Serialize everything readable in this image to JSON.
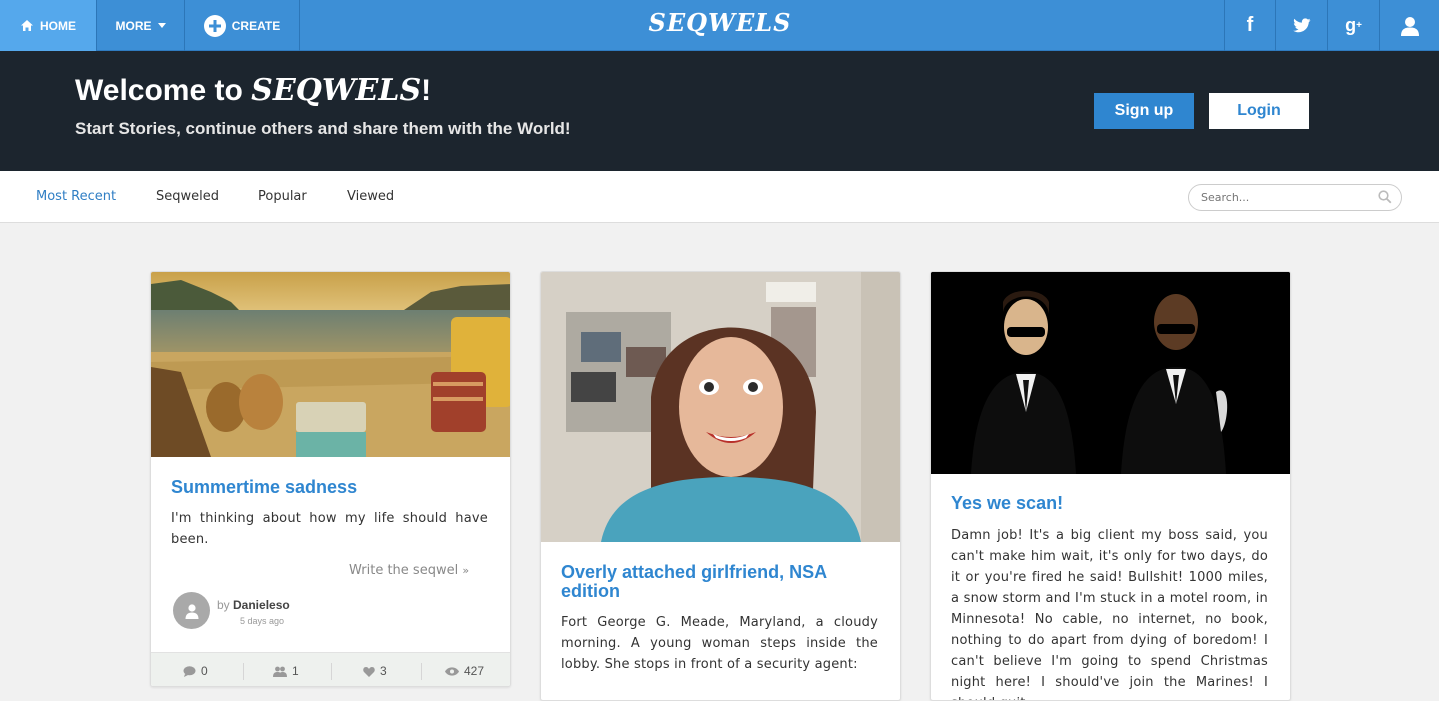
{
  "nav": {
    "home": "HOME",
    "more": "MORE",
    "create": "CREATE",
    "brand": "SEQWELS"
  },
  "hero": {
    "title_prefix": "Welcome to ",
    "title_brand": "SEQWELS",
    "title_suffix": "!",
    "subtitle": "Start Stories, continue others and share them with the World!",
    "signup": "Sign up",
    "login": "Login"
  },
  "filters": {
    "tabs": [
      "Most Recent",
      "Seqweled",
      "Popular",
      "Viewed"
    ],
    "active_tab": "Most Recent",
    "search_placeholder": "Search..."
  },
  "cards": [
    {
      "title": "Summertime sadness",
      "text": "I'm thinking about how my life should have been.",
      "write_seqwel": "Write the seqwel",
      "author_prefix": "by ",
      "author": "Danieleso",
      "time": "5 days ago",
      "stats": {
        "comments": "0",
        "seqwels": "1",
        "likes": "3",
        "views": "427"
      }
    },
    {
      "title": "Overly attached girlfriend, NSA edition",
      "text": "Fort George G. Meade, Maryland, a cloudy morning. A young woman steps inside the lobby. She stops in front of a security agent:"
    },
    {
      "title": "Yes we scan!",
      "text": "Damn job! It's a big client my boss said, you can't make him wait, it's only for two days, do it or you're fired he said! Bullshit! 1000 miles, a snow storm and I'm stuck in a motel room, in Minnesota! No cable, no internet, no book, nothing to do apart from dying of boredom! I can't believe I'm going to spend Christmas night here! I should've join the Marines! I should quit,"
    }
  ],
  "colors": {
    "nav_bg": "#3d8fd6",
    "hero_bg": "#1c252e",
    "accent": "#2f86d0"
  }
}
